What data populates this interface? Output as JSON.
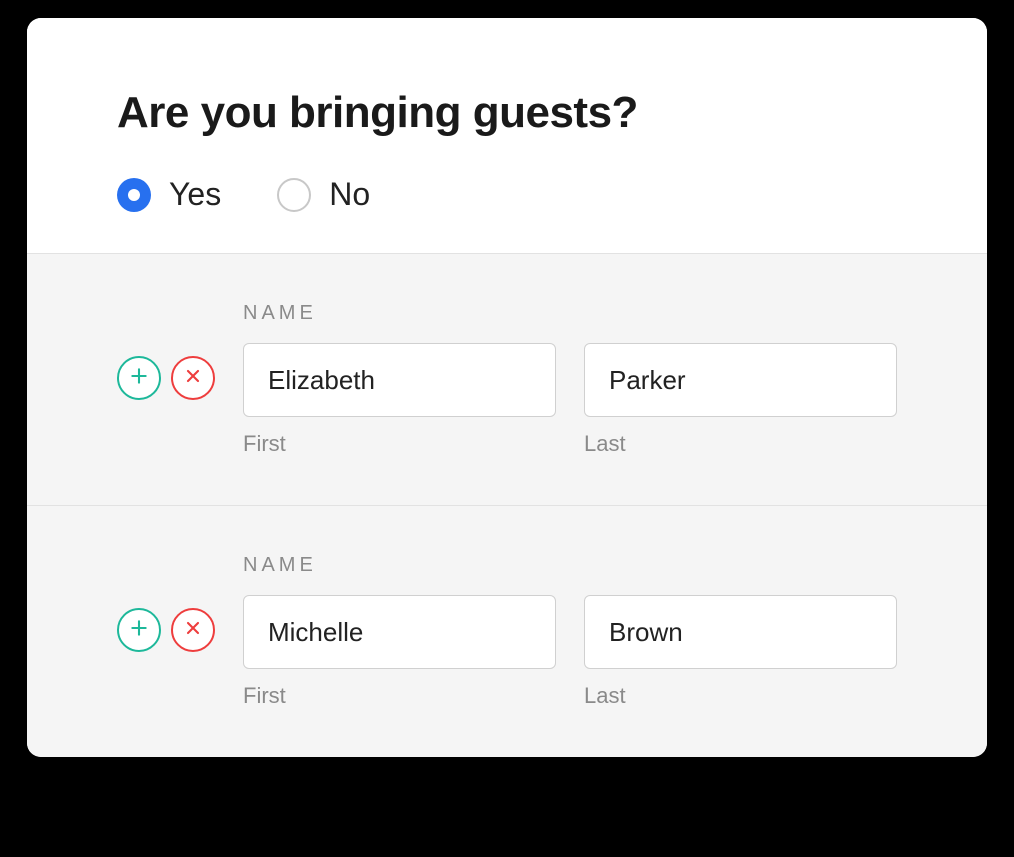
{
  "question": {
    "title": "Are you bringing guests?",
    "options": {
      "yes": "Yes",
      "no": "No"
    },
    "selected": "yes"
  },
  "guests": {
    "group_label": "NAME",
    "first_label": "First",
    "last_label": "Last",
    "rows": [
      {
        "first": "Elizabeth",
        "last": "Parker"
      },
      {
        "first": "Michelle",
        "last": "Brown"
      }
    ]
  },
  "colors": {
    "accent": "#2770ef",
    "add": "#1db89a",
    "remove": "#ee3d3d"
  }
}
